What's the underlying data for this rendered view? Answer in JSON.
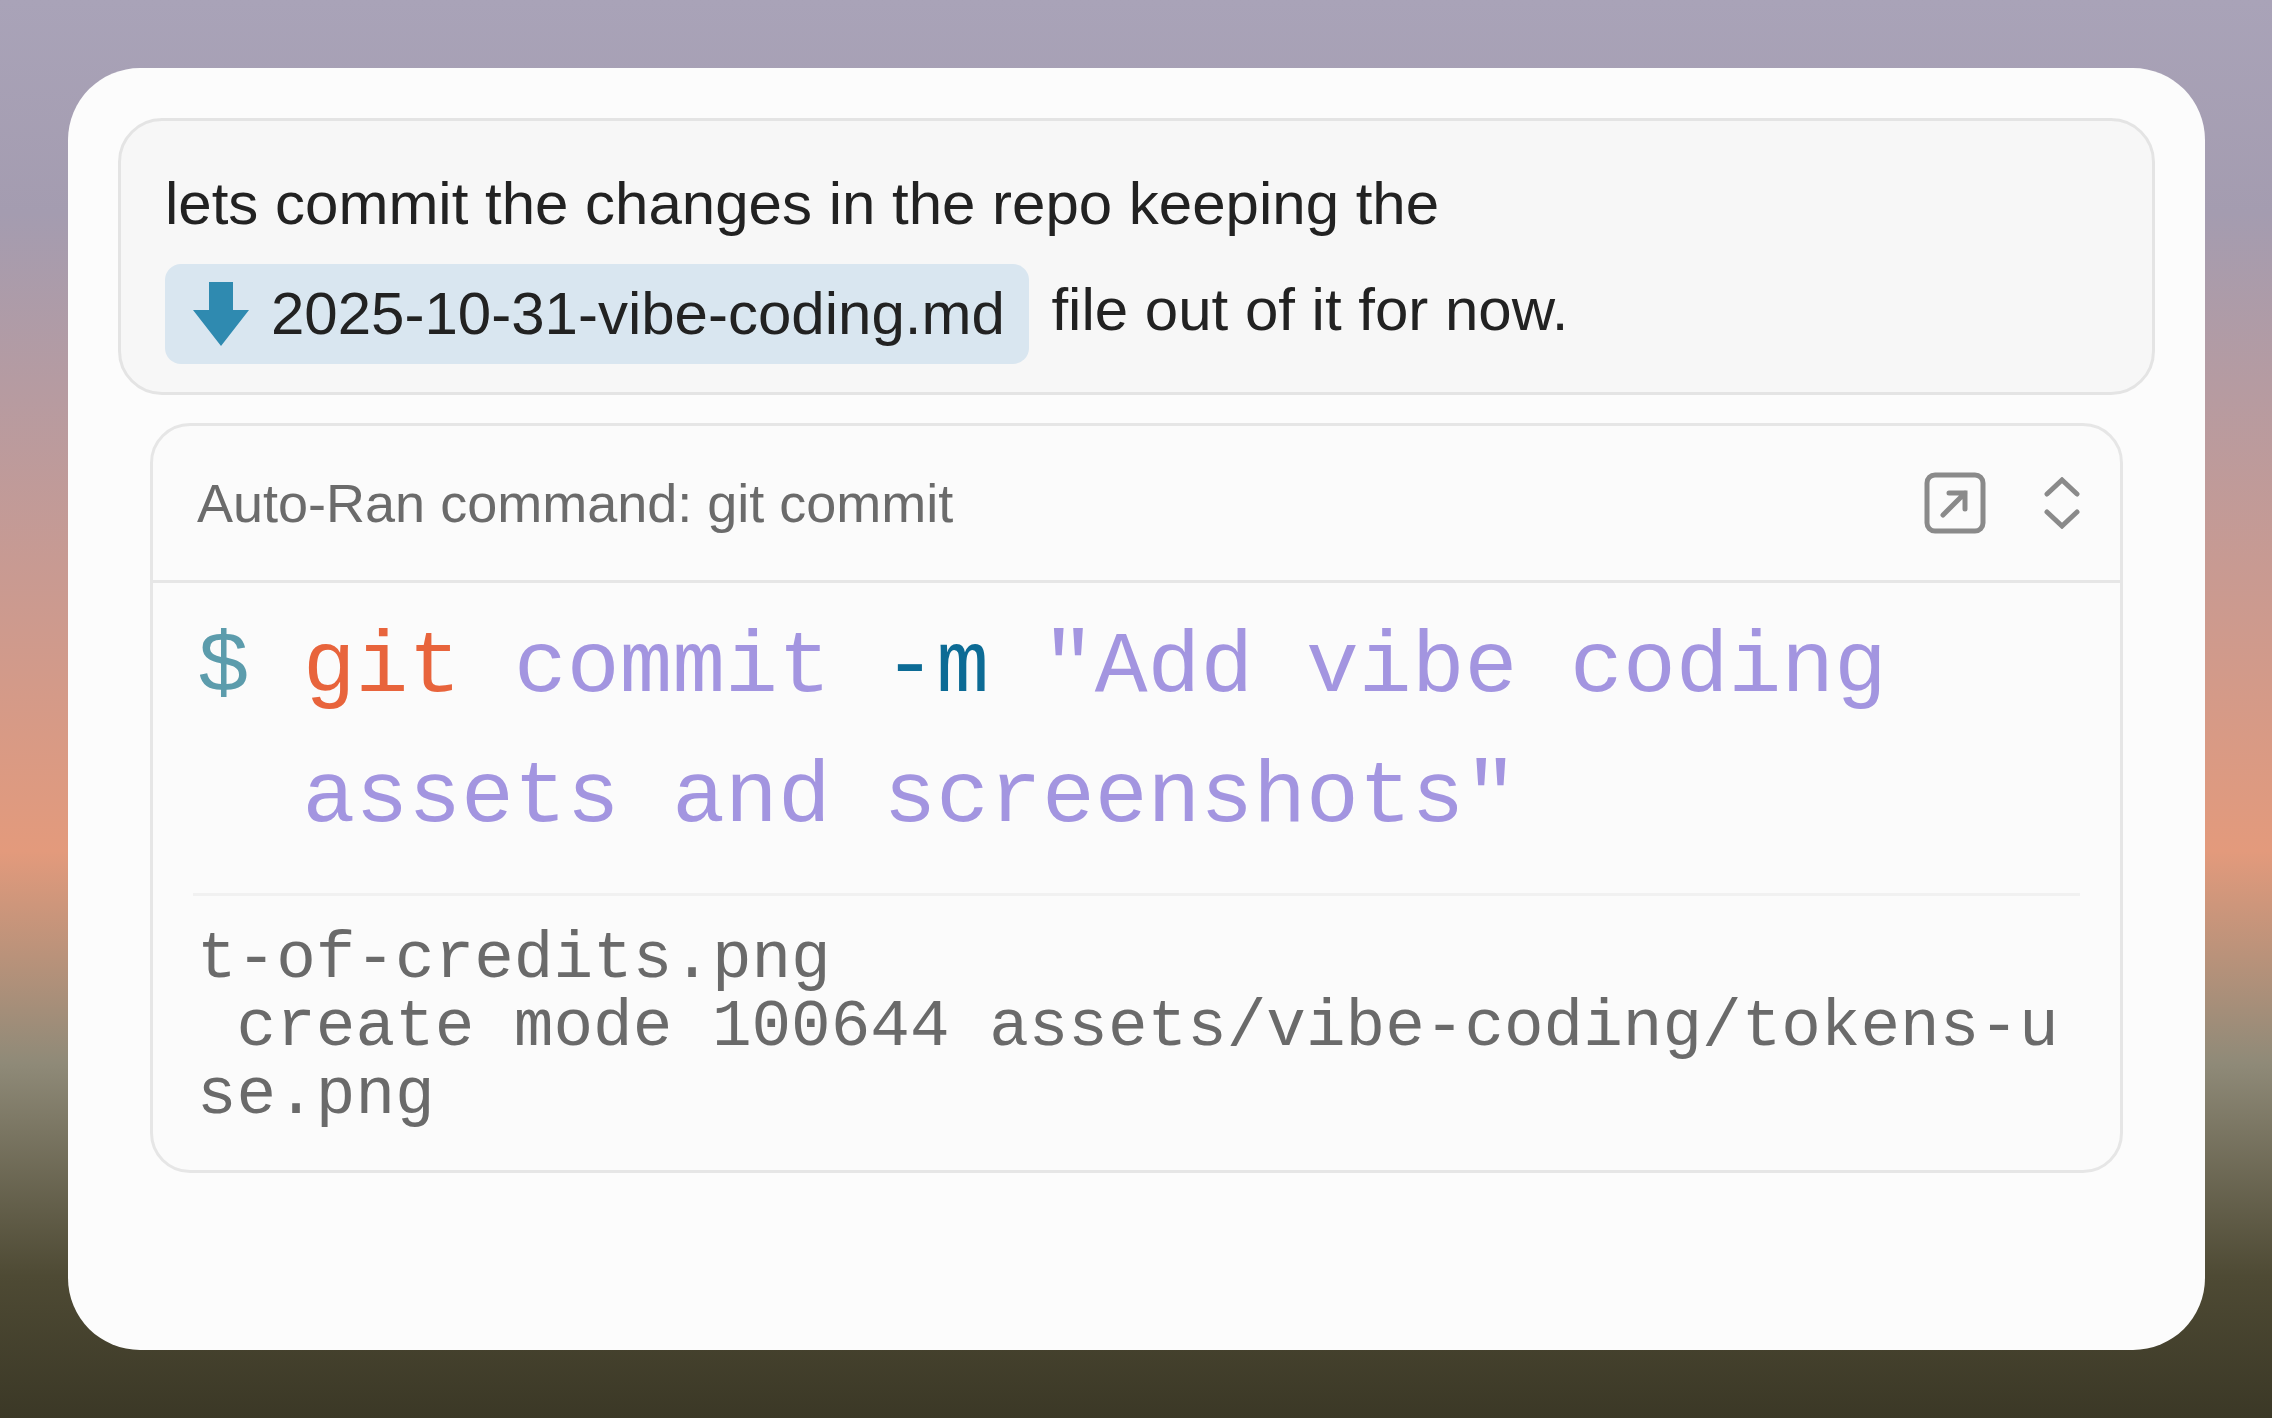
{
  "prompt": {
    "parts": [
      {
        "kind": "text",
        "text": "lets commit the changes in the repo keeping the"
      },
      {
        "kind": "file",
        "text": "2025-10-31-vibe-coding.md"
      },
      {
        "kind": "text",
        "text": "file out of it for now."
      }
    ]
  },
  "command": {
    "title": "Auto-Ran command: git commit",
    "code": [
      {
        "kind": "prompt",
        "text": "$"
      },
      {
        "kind": "program",
        "text": "git"
      },
      {
        "kind": "word",
        "text": "commit"
      },
      {
        "kind": "flag",
        "text": "-m"
      },
      {
        "kind": "string",
        "text": "\"Add vibe coding assets and screenshots\""
      }
    ],
    "output": "t-of-credits.png\n create mode 100644 assets/vibe-coding/tokens-u\nse.png"
  }
}
